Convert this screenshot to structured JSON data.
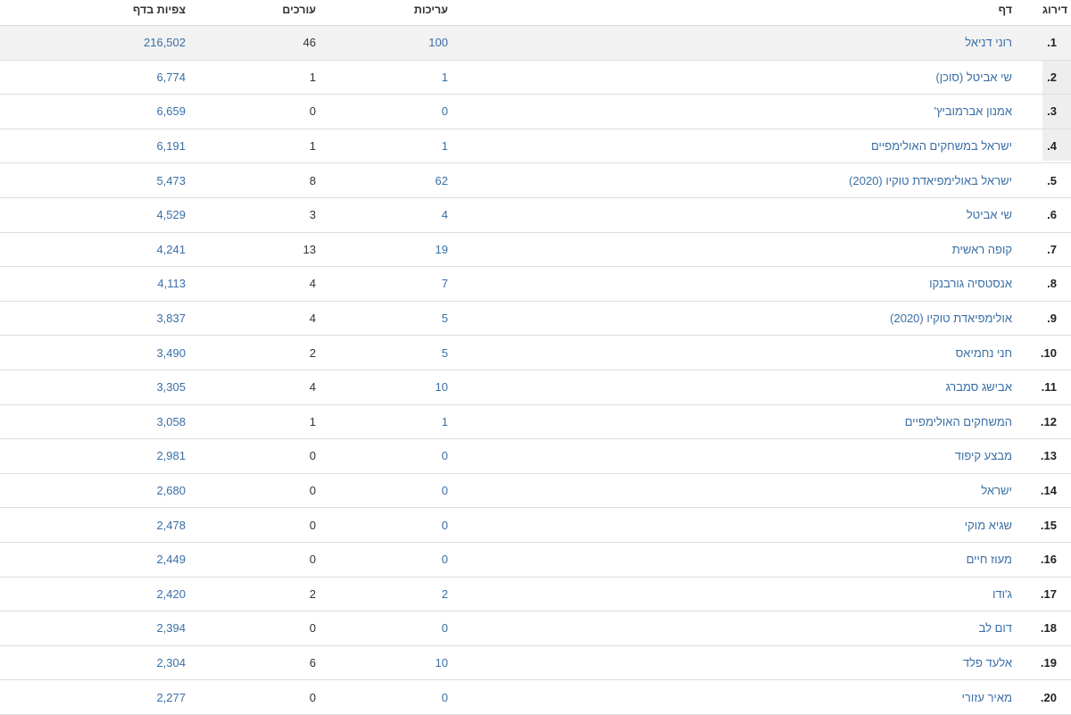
{
  "headers": {
    "rank": "דירוג",
    "page": "דף",
    "edits": "עריכות",
    "editors": "עורכים",
    "views": "צפיות בדף"
  },
  "rows": [
    {
      "rank": "1.",
      "page": "רוני דניאל",
      "edits": "100",
      "editors": "46",
      "views": "216,502"
    },
    {
      "rank": "2.",
      "page": "שי אביטל (סוכן)",
      "edits": "1",
      "editors": "1",
      "views": "6,774"
    },
    {
      "rank": "3.",
      "page": "אמנון אברמוביץ'",
      "edits": "0",
      "editors": "0",
      "views": "6,659"
    },
    {
      "rank": "4.",
      "page": "ישראל במשחקים האולימפיים",
      "edits": "1",
      "editors": "1",
      "views": "6,191"
    },
    {
      "rank": "5.",
      "page": "ישראל באולימפיאדת טוקיו (2020)",
      "edits": "62",
      "editors": "8",
      "views": "5,473"
    },
    {
      "rank": "6.",
      "page": "שי אביטל",
      "edits": "4",
      "editors": "3",
      "views": "4,529"
    },
    {
      "rank": "7.",
      "page": "קופה ראשית",
      "edits": "19",
      "editors": "13",
      "views": "4,241"
    },
    {
      "rank": "8.",
      "page": "אנסטסיה גורבנקו",
      "edits": "7",
      "editors": "4",
      "views": "4,113"
    },
    {
      "rank": "9.",
      "page": "אולימפיאדת טוקיו (2020)",
      "edits": "5",
      "editors": "4",
      "views": "3,837"
    },
    {
      "rank": "10.",
      "page": "חני נחמיאס",
      "edits": "5",
      "editors": "2",
      "views": "3,490"
    },
    {
      "rank": "11.",
      "page": "אבישג סמברג",
      "edits": "10",
      "editors": "4",
      "views": "3,305"
    },
    {
      "rank": "12.",
      "page": "המשחקים האולימפיים",
      "edits": "1",
      "editors": "1",
      "views": "3,058"
    },
    {
      "rank": "13.",
      "page": "מבצע קיפוד",
      "edits": "0",
      "editors": "0",
      "views": "2,981"
    },
    {
      "rank": "14.",
      "page": "ישראל",
      "edits": "0",
      "editors": "0",
      "views": "2,680"
    },
    {
      "rank": "15.",
      "page": "שגיא מוקי",
      "edits": "0",
      "editors": "0",
      "views": "2,478"
    },
    {
      "rank": "16.",
      "page": "מעוז חיים",
      "edits": "0",
      "editors": "0",
      "views": "2,449"
    },
    {
      "rank": "17.",
      "page": "ג'ודו",
      "edits": "2",
      "editors": "2",
      "views": "2,420"
    },
    {
      "rank": "18.",
      "page": "דום לב",
      "edits": "0",
      "editors": "0",
      "views": "2,394"
    },
    {
      "rank": "19.",
      "page": "אלעד פלד",
      "edits": "10",
      "editors": "6",
      "views": "2,304"
    },
    {
      "rank": "20.",
      "page": "מאיר עזורי",
      "edits": "0",
      "editors": "0",
      "views": "2,277"
    }
  ],
  "colors": {
    "link": "#3a6ea5",
    "text": "#333333",
    "first_row_bg": "#f2f2f2",
    "border": "#dedede"
  }
}
